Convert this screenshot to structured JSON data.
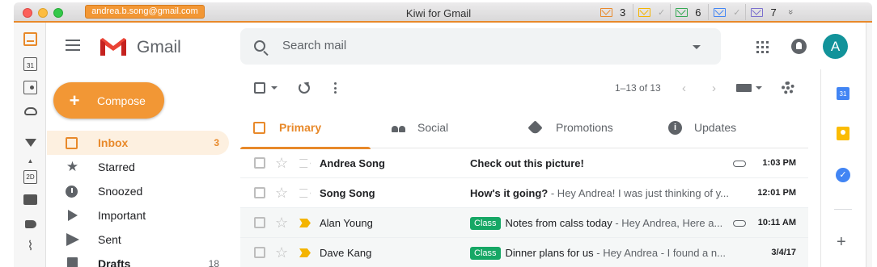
{
  "window": {
    "account": "andrea.b.song@gmail.com",
    "title": "Kiwi for Gmail",
    "accounts": [
      {
        "icon": "envelope-icon",
        "color": "#e8892a",
        "count": "3"
      },
      {
        "icon": "envelope-icon",
        "color": "#f4b400",
        "count": "✓"
      },
      {
        "icon": "envelope-icon",
        "color": "#34a853",
        "count": "6"
      },
      {
        "icon": "envelope-icon",
        "color": "#4285f4",
        "count": "✓"
      },
      {
        "icon": "envelope-icon",
        "color": "#7b6fce",
        "count": "7"
      }
    ],
    "more": "»"
  },
  "header": {
    "logo_text": "Gmail",
    "search_placeholder": "Search mail",
    "avatar_initial": "A",
    "avatar_color": "#12939a"
  },
  "compose_label": "Compose",
  "nav": [
    {
      "label": "Inbox",
      "count": "3",
      "icon": "inbox-icon"
    },
    {
      "label": "Starred",
      "count": "",
      "icon": "star-icon"
    },
    {
      "label": "Snoozed",
      "count": "",
      "icon": "clock-icon"
    },
    {
      "label": "Important",
      "count": "",
      "icon": "important-icon"
    },
    {
      "label": "Sent",
      "count": "",
      "icon": "send-icon"
    },
    {
      "label": "Drafts",
      "count": "18",
      "icon": "draft-icon"
    }
  ],
  "toolbar": {
    "page_count": "1–13 of 13",
    "prev": "‹",
    "next": "›"
  },
  "tabs": [
    {
      "label": "Primary",
      "icon": "inbox-icon"
    },
    {
      "label": "Social",
      "icon": "people-icon"
    },
    {
      "label": "Promotions",
      "icon": "tag-icon"
    },
    {
      "label": "Updates",
      "icon": "info-icon"
    }
  ],
  "emails": [
    {
      "sender": "Andrea Song",
      "label": "",
      "subject": "Check out this picture!",
      "preview": "",
      "attachment": true,
      "time": "1:03 PM",
      "unread": true,
      "important": false
    },
    {
      "sender": "Song Song",
      "label": "",
      "subject": "How's it going?",
      "preview": " - Hey Andrea! I was just thinking of y...",
      "attachment": false,
      "time": "12:01 PM",
      "unread": true,
      "important": false
    },
    {
      "sender": "Alan Young",
      "label": "Class",
      "subject": "Notes from calss today",
      "preview": " - Hey Andrea, Here a...",
      "attachment": true,
      "time": "10:11 AM",
      "unread": false,
      "important": true
    },
    {
      "sender": "Dave Kang",
      "label": "Class",
      "subject": "Dinner plans for us",
      "preview": " - Hey Andrea - I found a n...",
      "attachment": false,
      "time": "3/4/17",
      "unread": false,
      "important": true
    }
  ],
  "sidepanel": {
    "calendar_glyph": "31",
    "tasks_glyph": "✓",
    "add_glyph": "+"
  },
  "dock": {
    "calendar_glyph": "31",
    "zoom_glyph": "2D",
    "up_glyph": "▲",
    "clip_glyph": "⌇"
  }
}
